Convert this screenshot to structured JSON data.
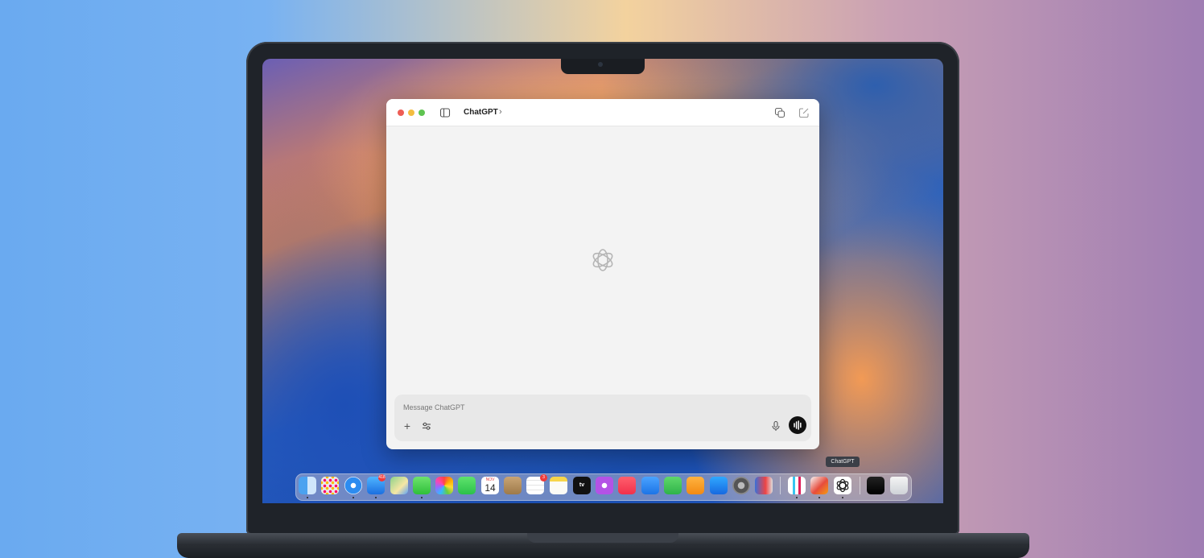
{
  "window": {
    "title": "ChatGPT",
    "title_chevron": "›"
  },
  "composer": {
    "placeholder": "Message ChatGPT",
    "plus_glyph": "+"
  },
  "dock": {
    "tooltip": "ChatGPT",
    "calendar_month": "NOV",
    "calendar_day": "14",
    "tv_label": "tv",
    "mail_badge": "418",
    "reminders_badge": "3"
  },
  "icons": [
    "sidebar-toggle-icon",
    "new-window-icon",
    "compose-icon",
    "openai-logo-icon",
    "plus-icon",
    "tools-icon",
    "microphone-icon",
    "voice-mode-icon"
  ],
  "colors": {
    "traffic_red": "#ee5d55",
    "traffic_yellow": "#f3bd40",
    "traffic_green": "#5fc451",
    "window_bg": "#f3f3f3",
    "composer_bg": "#e8e8e8"
  }
}
